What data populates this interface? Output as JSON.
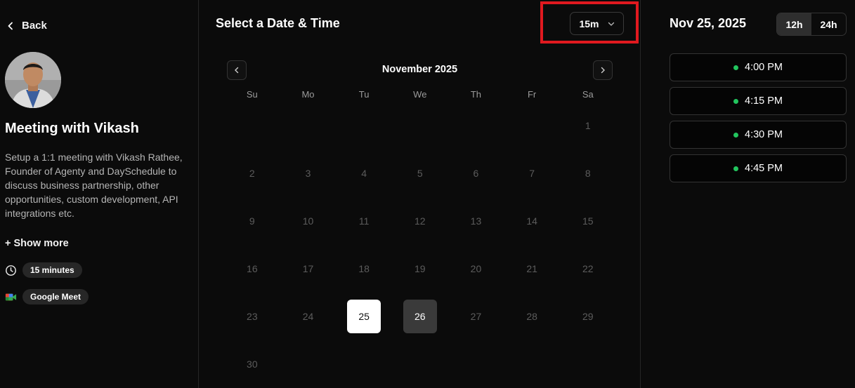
{
  "sidebar": {
    "back_label": "Back",
    "title": "Meeting with Vikash",
    "description": "Setup a 1:1 meeting with Vikash Rathee, Founder of Agenty and DaySchedule to discuss business partnership, other opportunities, custom development, API integrations etc.",
    "show_more": "+ Show more",
    "duration": "15 minutes",
    "location": "Google Meet"
  },
  "calendar": {
    "heading": "Select a Date & Time",
    "duration_select": "15m",
    "month": "November 2025",
    "weekdays": [
      "Su",
      "Mo",
      "Tu",
      "We",
      "Th",
      "Fr",
      "Sa"
    ],
    "leading_blanks": 6,
    "days": [
      1,
      2,
      3,
      4,
      5,
      6,
      7,
      8,
      9,
      10,
      11,
      12,
      13,
      14,
      15,
      16,
      17,
      18,
      19,
      20,
      21,
      22,
      23,
      24,
      25,
      26,
      27,
      28,
      29,
      30
    ],
    "selected_day": 25,
    "available_days": [
      26
    ]
  },
  "times": {
    "date": "Nov 25, 2025",
    "format_12h": "12h",
    "format_24h": "24h",
    "selected_format": "12h",
    "slots": [
      "4:00 PM",
      "4:15 PM",
      "4:30 PM",
      "4:45 PM"
    ],
    "available_color": "#22c55e"
  }
}
